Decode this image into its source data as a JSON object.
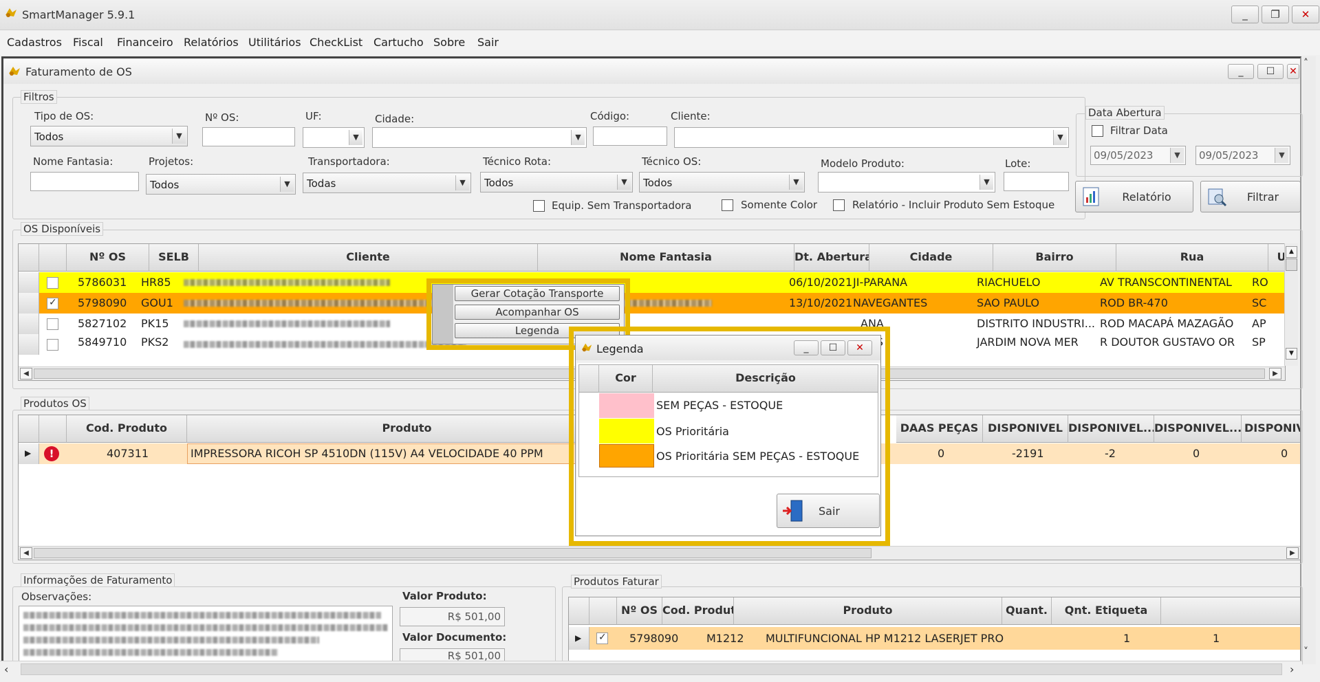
{
  "app": {
    "title": "SmartManager 5.9.1"
  },
  "menu": [
    "Cadastros",
    "Fiscal",
    "Financeiro",
    "Relatórios",
    "Utilitários",
    "CheckList",
    "Cartucho",
    "Sobre",
    "Sair"
  ],
  "window": {
    "title": "Faturamento de OS"
  },
  "filtros": {
    "group_label": "Filtros",
    "tipo_os": {
      "label": "Tipo de OS:",
      "value": "Todos"
    },
    "num_os": {
      "label": "Nº OS:",
      "value": ""
    },
    "uf": {
      "label": "UF:",
      "value": ""
    },
    "cidade": {
      "label": "Cidade:",
      "value": ""
    },
    "codigo": {
      "label": "Código:",
      "value": ""
    },
    "cliente": {
      "label": "Cliente:",
      "value": ""
    },
    "nome_fantasia": {
      "label": "Nome Fantasia:",
      "value": ""
    },
    "projetos": {
      "label": "Projetos:",
      "value": "Todos"
    },
    "transportadora": {
      "label": "Transportadora:",
      "value": "Todas"
    },
    "tecnico_rota": {
      "label": "Técnico Rota:",
      "value": "Todos"
    },
    "tecnico_os": {
      "label": "Técnico OS:",
      "value": "Todos"
    },
    "modelo_produto": {
      "label": "Modelo Produto:",
      "value": ""
    },
    "lote": {
      "label": "Lote:",
      "value": ""
    },
    "equip_sem_transp": "Equip. Sem Transportadora",
    "somente_color": "Somente Color",
    "relatorio_incluir": "Relatório - Incluir Produto Sem Estoque",
    "data_abertura": {
      "label": "Data Abertura",
      "filtrar": "Filtrar Data",
      "de": "09/05/2023",
      "ate": "09/05/2023"
    },
    "btn_relatorio": "Relatório",
    "btn_filtrar": "Filtrar"
  },
  "os_disponiveis": {
    "group_label": "OS Disponíveis",
    "columns": [
      "Nº OS",
      "SELB",
      "Cliente",
      "Nome Fantasia",
      "Dt. Abertura",
      "Cidade",
      "Bairro",
      "Rua",
      "UF"
    ],
    "rows": [
      {
        "num": "5786031",
        "selb": "HR85",
        "dt": "06/10/2021",
        "cidade": "JI-PARANA",
        "bairro": "RIACHUELO",
        "rua": "AV TRANSCONTINENTAL",
        "uf": "RO",
        "color": "#ffff00",
        "checked": false
      },
      {
        "num": "5798090",
        "selb": "GOU1",
        "dt": "13/10/2021",
        "cidade": "NAVEGANTES",
        "bairro": "SAO PAULO",
        "rua": "ROD BR-470",
        "uf": "SC",
        "color": "#ffa500",
        "checked": true
      },
      {
        "num": "5827102",
        "selb": "PK15",
        "dt": "",
        "cidade": "ANA",
        "bairro": "DISTRITO  INDUSTRI...",
        "rua": "ROD MACAPÁ MAZAGÃO",
        "uf": "AP",
        "color": "#ffffff",
        "checked": false
      },
      {
        "num": "5849710",
        "selb": "PKS2",
        "dt": "",
        "cidade": "NAS",
        "bairro": "JARDIM NOVA MER",
        "rua": "R DOUTOR GUSTAVO OR",
        "uf": "SP",
        "color": "#ffffff",
        "checked": false
      }
    ]
  },
  "context_menu": [
    "Gerar Cotação Transporte",
    "Acompanhar OS",
    "Legenda"
  ],
  "produtos_os": {
    "group_label": "Produtos OS",
    "columns": [
      "Cod. Produto",
      "Produto",
      "DAAS PEÇAS",
      "DISPONIVEL",
      "DISPONIVEL...",
      "DISPONIVEL...",
      "DISPONIV"
    ],
    "rows": [
      {
        "cod": "407311",
        "produto": "IMPRESSORA RICOH SP 4510DN (115V) A4 VELOCIDADE 40 PPM",
        "daas": "0",
        "disp": "-2191",
        "disp2": "-2",
        "disp3": "0",
        "disp4": "0"
      }
    ]
  },
  "legenda": {
    "title": "Legenda",
    "columns": [
      "Cor",
      "Descrição"
    ],
    "rows": [
      {
        "color": "#ffc0cb",
        "desc": "SEM PEÇAS - ESTOQUE"
      },
      {
        "color": "#ffff00",
        "desc": "OS Prioritária"
      },
      {
        "color": "#ffa500",
        "desc": "OS Prioritária SEM PEÇAS - ESTOQUE"
      }
    ],
    "btn_sair": "Sair"
  },
  "informacoes": {
    "group_label": "Informações de Faturamento",
    "observacoes_label": "Observações:",
    "valor_produto_label": "Valor Produto:",
    "valor_produto": "R$ 501,00",
    "valor_documento_label": "Valor Documento:",
    "valor_documento": "R$ 501,00"
  },
  "produtos_faturar": {
    "group_label": "Produtos Faturar",
    "columns": [
      "Nº OS",
      "Cod. Produto",
      "Produto",
      "Quant.",
      "Qnt. Etiqueta"
    ],
    "rows": [
      {
        "num": "5798090",
        "cod": "M1212",
        "produto": "MULTIFUNCIONAL HP M1212 LASERJET PRO",
        "quant": "1",
        "etiqueta": "1"
      }
    ]
  },
  "colors": {
    "highlight": "#e6b800",
    "priority": "#ffff00",
    "priority_no_parts": "#ffa500",
    "faturar_row": "#ffd89a",
    "produto_row": "#ffe4bd"
  }
}
